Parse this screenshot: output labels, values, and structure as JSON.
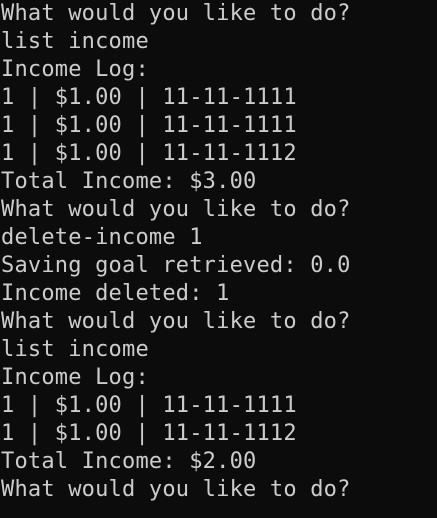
{
  "terminal": {
    "background": "#0c0c0c",
    "foreground": "#cccccc",
    "lines": [
      "What would you like to do?",
      "list income",
      "Income Log:",
      "1 | $1.00 | 11-11-1111",
      "1 | $1.00 | 11-11-1111",
      "1 | $1.00 | 11-11-1112",
      "Total Income: $3.00",
      "What would you like to do?",
      "delete-income 1",
      "Saving goal retrieved: 0.0",
      "Income deleted: 1",
      "What would you like to do?",
      "list income",
      "Income Log:",
      "1 | $1.00 | 11-11-1111",
      "1 | $1.00 | 11-11-1112",
      "Total Income: $2.00",
      "What would you like to do?"
    ]
  }
}
